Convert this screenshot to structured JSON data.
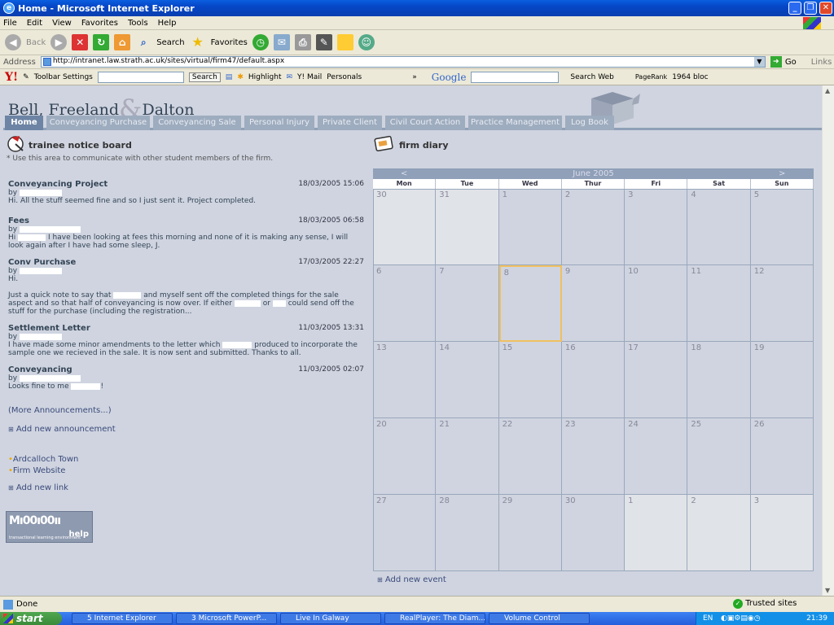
{
  "window": {
    "title": "Home - Microsoft Internet Explorer"
  },
  "menu": [
    "File",
    "Edit",
    "View",
    "Favorites",
    "Tools",
    "Help"
  ],
  "toolbar": {
    "back": "Back",
    "search": "Search",
    "favorites": "Favorites"
  },
  "address": {
    "label": "Address",
    "url": "http://intranet.law.strath.ac.uk/sites/virtual/firm47/default.aspx",
    "go": "Go",
    "links": "Links"
  },
  "yahoo": {
    "settings": "Toolbar Settings",
    "search": "Search",
    "highlight": "Highlight",
    "mail": "Y! Mail",
    "personals": "Personals",
    "google": "Google",
    "search_web": "Search Web",
    "pagerank": "PageRank",
    "blocked": "1964 bloc"
  },
  "site": {
    "logo": {
      "a": "Bell, Freeland",
      "amp": "&",
      "b": "Dalton"
    },
    "tabs": [
      "Home",
      "Conveyancing Purchase",
      "Conveyancing Sale",
      "Personal Injury",
      "Private Client",
      "Civil Court Action",
      "Practice Management",
      "Log Book"
    ],
    "notice": {
      "title": "trainee notice board",
      "note": "Use this area to communicate with other student members of the firm.",
      "announcements": [
        {
          "title": "Conveyancing Project",
          "date": "18/03/2005 15:06",
          "by": "by",
          "text": "Hi. All the stuff seemed fine and so I just sent it. Project completed."
        },
        {
          "title": "Fees",
          "date": "18/03/2005 06:58",
          "by": "by",
          "text_a": "Hi",
          "text_b": "I have been looking at fees this morning and none of it is making any sense, I will look again after I have had some sleep, J."
        },
        {
          "title": "Conv Purchase",
          "date": "17/03/2005 22:27",
          "by": "by",
          "text_a": "Hi.",
          "text_b": "Just a quick note to say that",
          "text_c": "and myself sent off the completed things for the sale aspect and so that half of conveyancing is now over. If either",
          "text_d": "or",
          "text_e": "could send off the stuff for the purchase (including the registration..."
        },
        {
          "title": "Settlement Letter",
          "date": "11/03/2005 13:31",
          "by": "by",
          "text_a": "I have made some minor amendments to the letter which",
          "text_b": "produced to incorporate the sample one we recieved in the sale. It is now sent and submitted. Thanks to all."
        },
        {
          "title": "Conveyancing",
          "date": "11/03/2005 02:07",
          "by": "by",
          "text_a": "Looks fine to me",
          "text_b": "!"
        }
      ],
      "more": "(More Announcements...)",
      "add_announcement": "Add new announcement",
      "links": [
        "Ardcalloch Town",
        "Firm Website"
      ],
      "add_link": "Add new link",
      "tle_help": "help",
      "tle_sub": "transactional learning environment"
    },
    "diary": {
      "title": "firm diary",
      "month": "June 2005",
      "prev": "<",
      "next": ">",
      "days": [
        "Mon",
        "Tue",
        "Wed",
        "Thur",
        "Fri",
        "Sat",
        "Sun"
      ],
      "weeks": [
        [
          "30",
          "31",
          "1",
          "2",
          "3",
          "4",
          "5"
        ],
        [
          "6",
          "7",
          "8",
          "9",
          "10",
          "11",
          "12"
        ],
        [
          "13",
          "14",
          "15",
          "16",
          "17",
          "18",
          "19"
        ],
        [
          "20",
          "21",
          "22",
          "23",
          "24",
          "25",
          "26"
        ],
        [
          "27",
          "28",
          "29",
          "30",
          "1",
          "2",
          "3"
        ]
      ],
      "add_event": "Add new event"
    }
  },
  "status": {
    "left": "Done",
    "zone": "Trusted sites"
  },
  "taskbar": {
    "start": "start",
    "tasks": [
      "5 Internet Explorer",
      "3 Microsoft PowerP...",
      "Live In Galway",
      "RealPlayer: The Diam...",
      "Volume Control"
    ],
    "lang": "EN",
    "time": "21:39"
  }
}
